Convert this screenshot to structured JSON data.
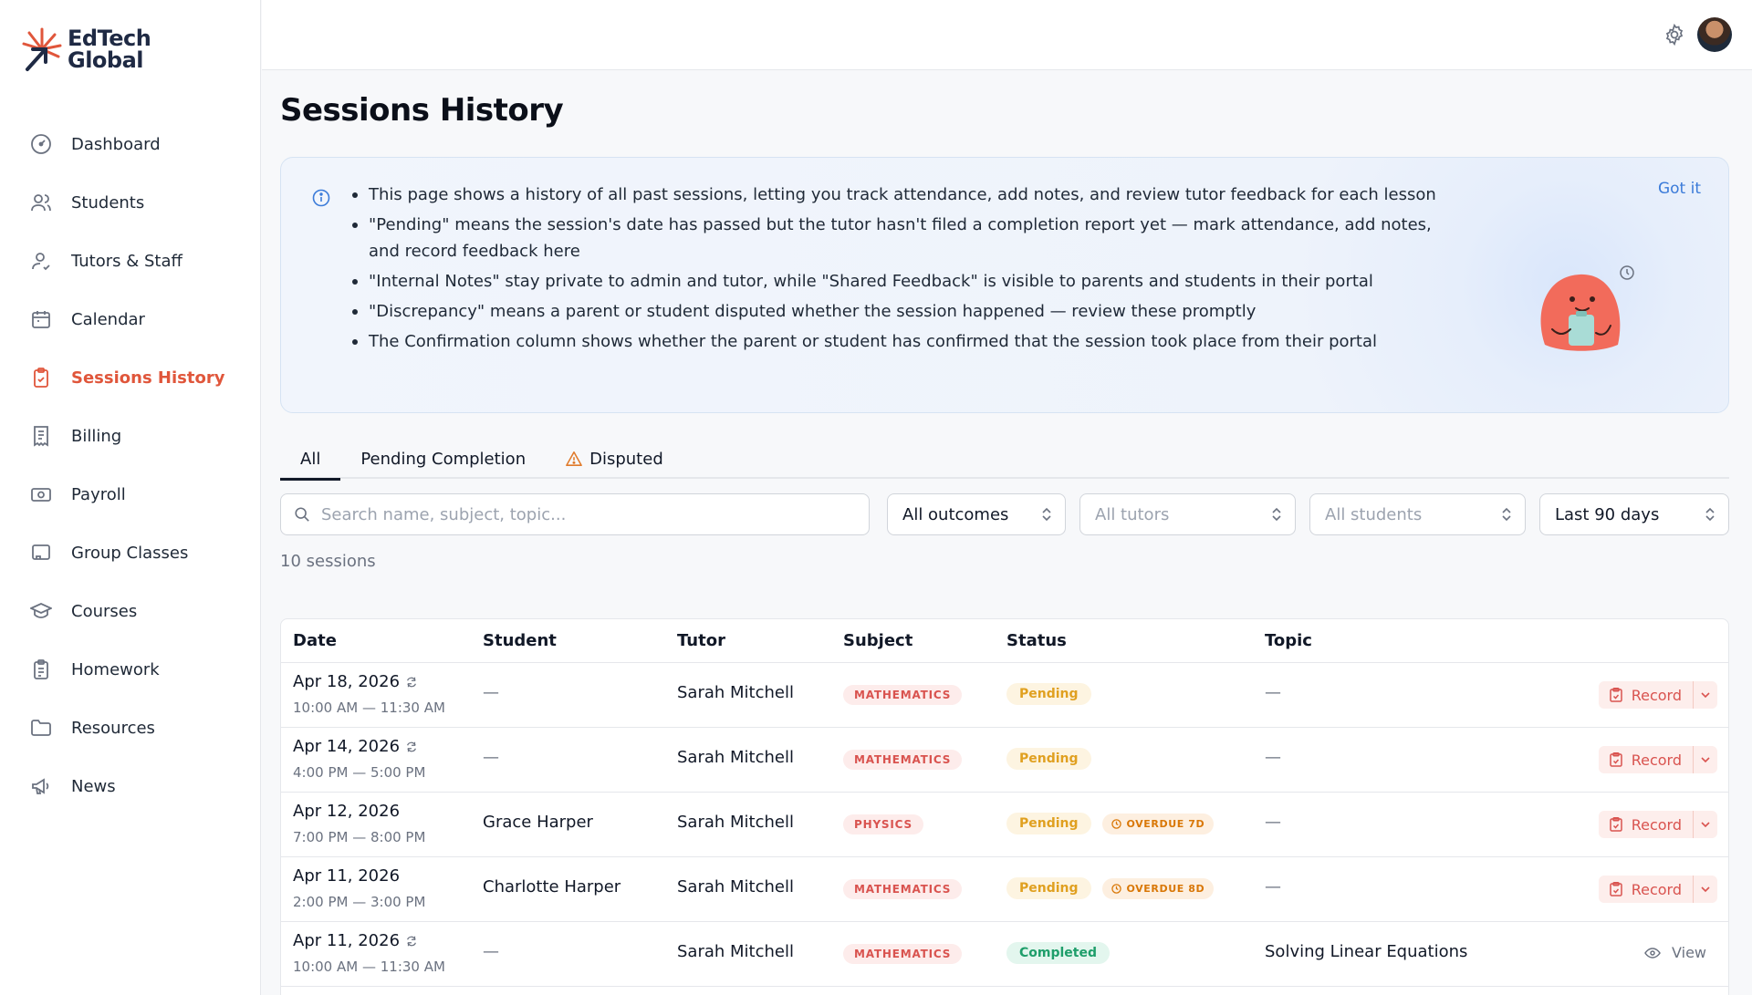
{
  "brand": {
    "line1": "EdTech",
    "line2": "Global"
  },
  "sidebar": {
    "items": [
      {
        "label": "Dashboard",
        "icon": "dashboard-icon"
      },
      {
        "label": "Students",
        "icon": "students-icon"
      },
      {
        "label": "Tutors & Staff",
        "icon": "tutors-icon"
      },
      {
        "label": "Calendar",
        "icon": "calendar-icon"
      },
      {
        "label": "Sessions History",
        "icon": "clipboard-icon",
        "active": true
      },
      {
        "label": "Billing",
        "icon": "receipt-icon"
      },
      {
        "label": "Payroll",
        "icon": "payroll-icon"
      },
      {
        "label": "Group Classes",
        "icon": "group-classes-icon"
      },
      {
        "label": "Courses",
        "icon": "graduation-cap-icon"
      },
      {
        "label": "Homework",
        "icon": "homework-icon"
      },
      {
        "label": "Resources",
        "icon": "folder-icon"
      },
      {
        "label": "News",
        "icon": "megaphone-icon"
      }
    ]
  },
  "header": {
    "settings_icon": "gear-icon",
    "avatar": "user-avatar"
  },
  "page": {
    "title": "Sessions History"
  },
  "info": {
    "got_it": "Got it",
    "bullets": [
      "This page shows a history of all past sessions, letting you track attendance, add notes, and review tutor feedback for each lesson",
      "\"Pending\" means the session's date has passed but the tutor hasn't filed a completion report yet — mark attendance, add notes, and record feedback here",
      "\"Internal Notes\" stay private to admin and tutor, while \"Shared Feedback\" is visible to parents and students in their portal",
      "\"Discrepancy\" means a parent or student disputed whether the session happened — review these promptly",
      "The Confirmation column shows whether the parent or student has confirmed that the session took place from their portal"
    ]
  },
  "tabs": [
    {
      "label": "All",
      "active": true
    },
    {
      "label": "Pending Completion"
    },
    {
      "label": "Disputed",
      "icon": "warning-icon"
    }
  ],
  "filters": {
    "search_placeholder": "Search name, subject, topic...",
    "outcomes": "All outcomes",
    "tutors": "All tutors",
    "students": "All students",
    "range": "Last 90 days"
  },
  "count": "10 sessions",
  "table": {
    "headers": {
      "date": "Date",
      "student": "Student",
      "tutor": "Tutor",
      "subject": "Subject",
      "status": "Status",
      "topic": "Topic"
    },
    "rows": [
      {
        "date": "Apr 18, 2026",
        "recurring": true,
        "time": "10:00 AM — 11:30 AM",
        "student": "—",
        "tutor": "Sarah Mitchell",
        "subject": "MATHEMATICS",
        "status": "Pending",
        "overdue": "",
        "topic": "—",
        "action": "Record"
      },
      {
        "date": "Apr 14, 2026",
        "recurring": true,
        "time": "4:00 PM — 5:00 PM",
        "student": "—",
        "tutor": "Sarah Mitchell",
        "subject": "MATHEMATICS",
        "status": "Pending",
        "overdue": "",
        "topic": "—",
        "action": "Record"
      },
      {
        "date": "Apr 12, 2026",
        "recurring": false,
        "time": "7:00 PM — 8:00 PM",
        "student": "Grace Harper",
        "tutor": "Sarah Mitchell",
        "subject": "PHYSICS",
        "status": "Pending",
        "overdue": "OVERDUE 7D",
        "topic": "—",
        "action": "Record"
      },
      {
        "date": "Apr 11, 2026",
        "recurring": false,
        "time": "2:00 PM — 3:00 PM",
        "student": "Charlotte Harper",
        "tutor": "Sarah Mitchell",
        "subject": "MATHEMATICS",
        "status": "Pending",
        "overdue": "OVERDUE 8D",
        "topic": "—",
        "action": "Record"
      },
      {
        "date": "Apr 11, 2026",
        "recurring": true,
        "time": "10:00 AM — 11:30 AM",
        "student": "—",
        "tutor": "Sarah Mitchell",
        "subject": "MATHEMATICS",
        "status": "Completed",
        "overdue": "",
        "topic": "Solving Linear Equations",
        "action": "View"
      }
    ]
  },
  "colors": {
    "accent": "#e0563b",
    "link": "#3b7bd9",
    "pending": "#e0a020",
    "completed": "#1e9e6a"
  }
}
